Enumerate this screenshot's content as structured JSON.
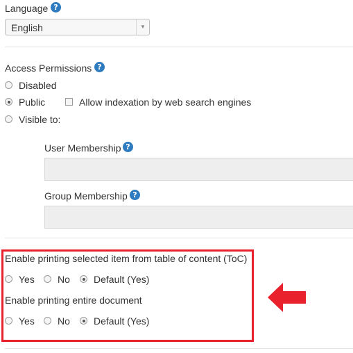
{
  "language": {
    "label": "Language",
    "help_icon": "?",
    "selected": "English"
  },
  "access": {
    "label": "Access Permissions",
    "help_icon": "?",
    "options": [
      "Disabled",
      "Public",
      "Visible to:"
    ],
    "selected": "Public",
    "indexation_label": "Allow indexation by web search engines",
    "indexation_checked": false,
    "user_membership_label": "User Membership",
    "group_membership_label": "Group Membership"
  },
  "printing": {
    "toc_label": "Enable printing selected item from table of content (ToC)",
    "toc_options": [
      "Yes",
      "No",
      "Default (Yes)"
    ],
    "toc_selected": "Default (Yes)",
    "doc_label": "Enable printing entire document",
    "doc_options": [
      "Yes",
      "No",
      "Default (Yes)"
    ],
    "doc_selected": "Default (Yes)"
  },
  "colors": {
    "help_icon": "#2e7bbf",
    "highlight_box": "#e8212c",
    "arrow": "#e8212c"
  }
}
